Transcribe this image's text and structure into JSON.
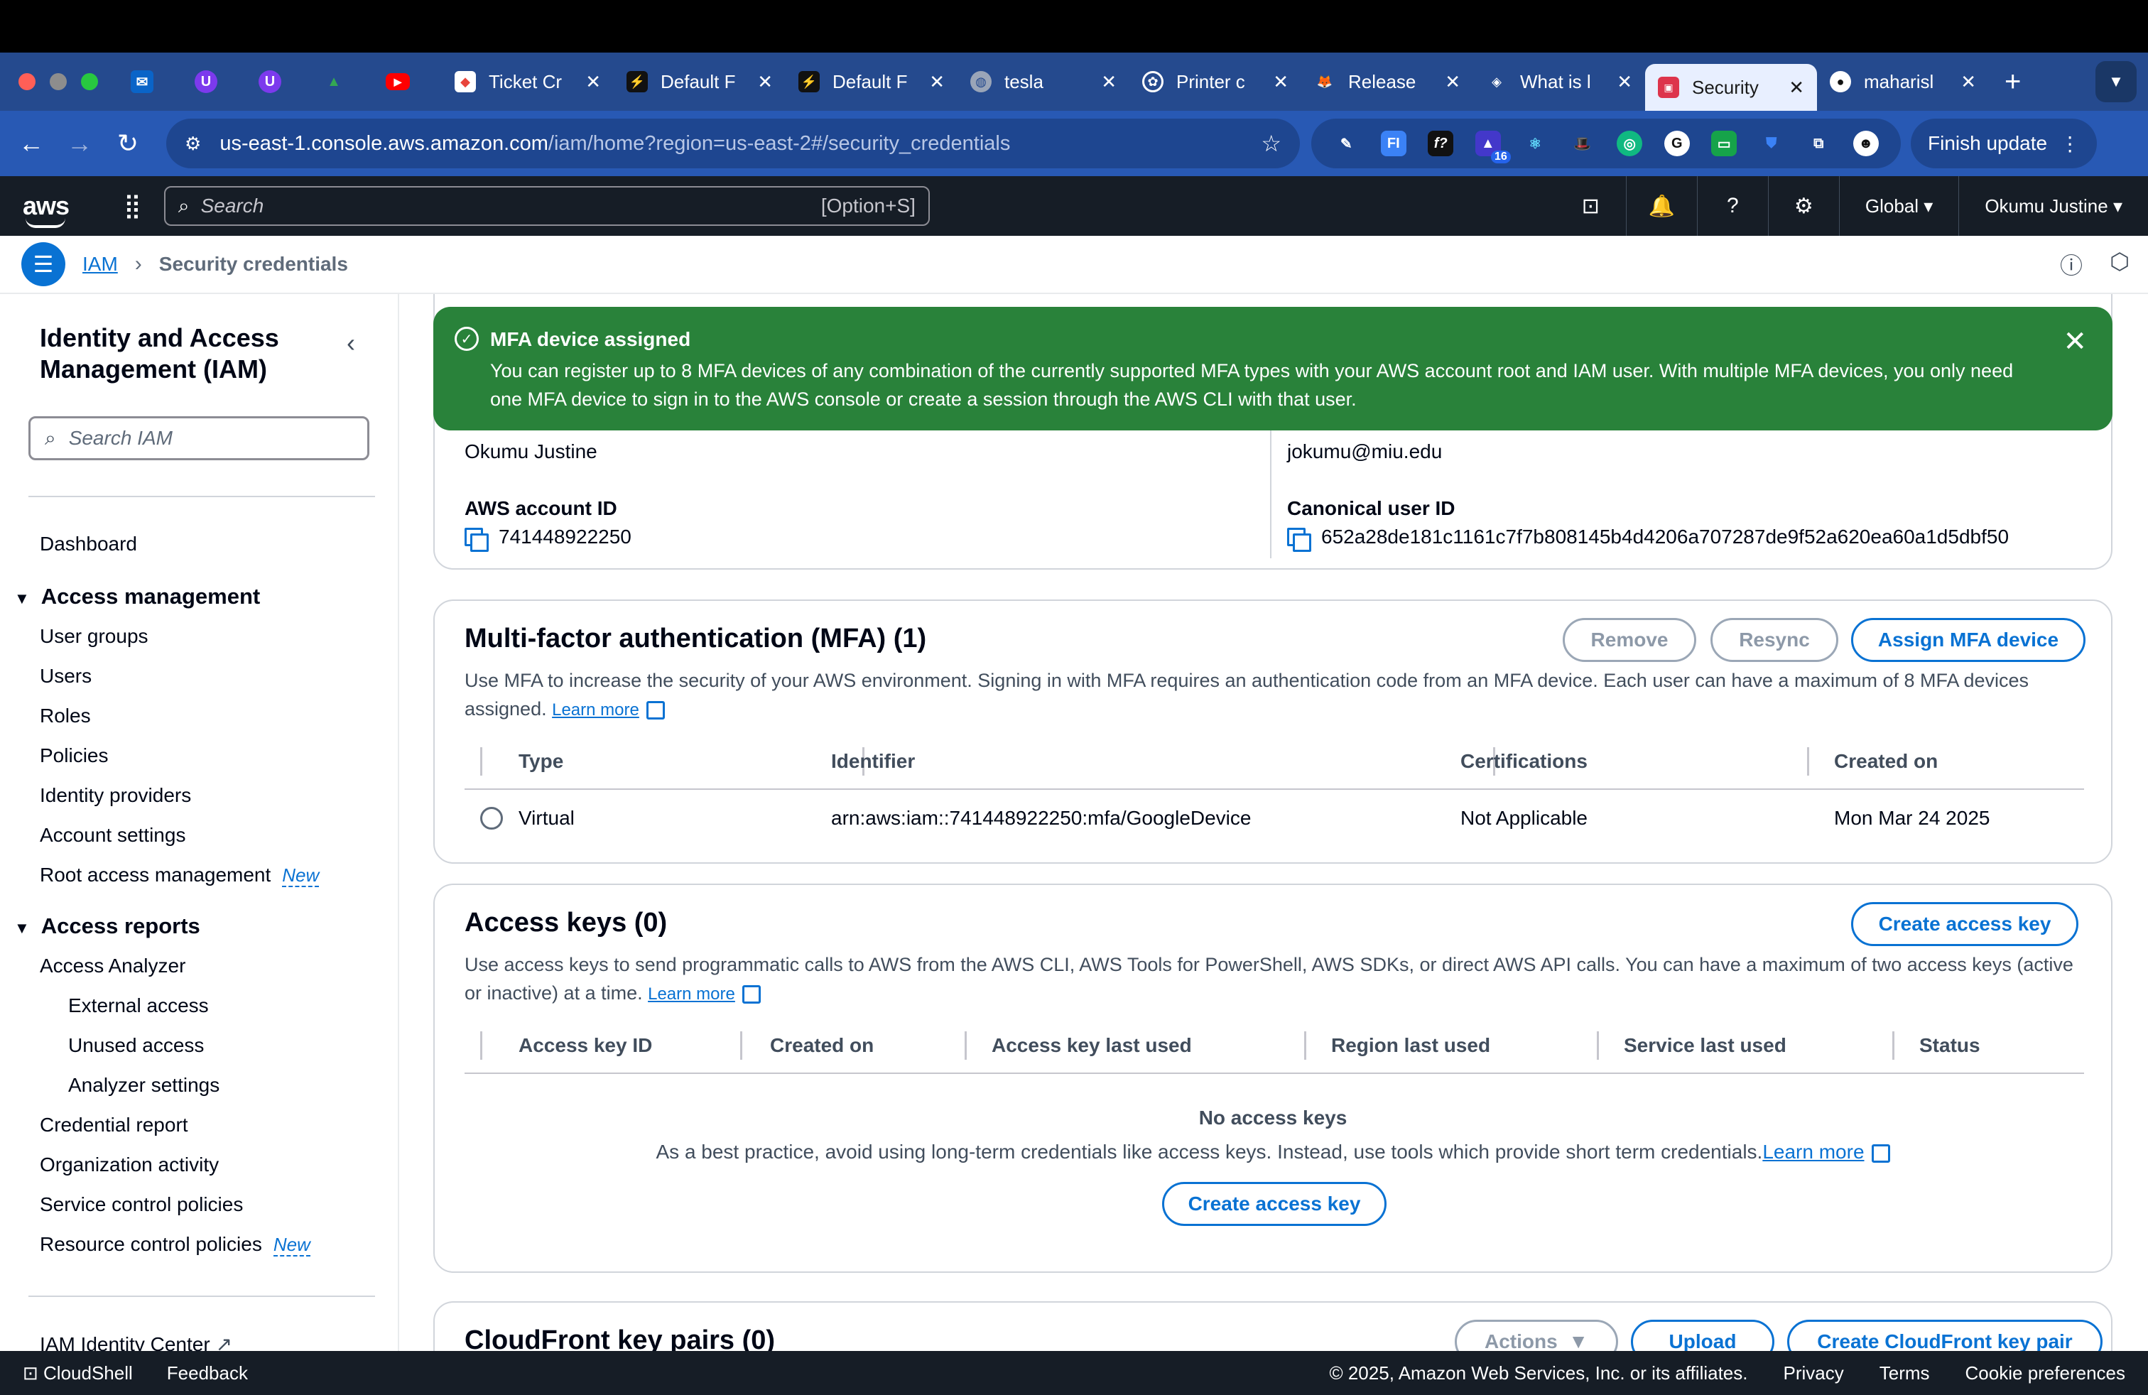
{
  "browser": {
    "tabs": [
      {
        "title": "Ticket Cr",
        "icon": "ticket-icon",
        "color": "#e8453c"
      },
      {
        "title": "Default F",
        "icon": "bolt-icon",
        "color": "#1f2937"
      },
      {
        "title": "Default F",
        "icon": "bolt-icon",
        "color": "#1f2937"
      },
      {
        "title": "tesla",
        "icon": "globe-icon",
        "color": "#6b7280"
      },
      {
        "title": "Printer c",
        "icon": "openai-icon",
        "color": "#111827"
      },
      {
        "title": "Release",
        "icon": "gitlab-icon",
        "color": "#e24329"
      },
      {
        "title": "What is l",
        "icon": "hf-icon",
        "color": "#374151"
      },
      {
        "title": "Security",
        "icon": "aws-icon",
        "color": "#c7254e"
      },
      {
        "title": "maharisl",
        "icon": "github-icon",
        "color": "#111827"
      }
    ],
    "url_host": "us-east-1.console.aws.amazon.com",
    "url_path": "/iam/home?region=us-east-2#/security_credentials",
    "extension_badge": "16",
    "finish_update": "Finish update"
  },
  "aws_nav": {
    "logo": "aws",
    "search_placeholder": "Search",
    "search_shortcut": "[Option+S]",
    "region": "Global",
    "account": "Okumu Justine"
  },
  "breadcrumb": {
    "root": "IAM",
    "current": "Security credentials"
  },
  "sidebar": {
    "title": "Identity and Access Management (IAM)",
    "search_placeholder": "Search IAM",
    "dashboard": "Dashboard",
    "access_management": "Access management",
    "am_items": [
      "User groups",
      "Users",
      "Roles",
      "Policies",
      "Identity providers",
      "Account settings",
      "Root access management"
    ],
    "access_reports": "Access reports",
    "access_analyzer": "Access Analyzer",
    "analyzer_items": [
      "External access",
      "Unused access",
      "Analyzer settings"
    ],
    "ar_items": [
      "Credential report",
      "Organization activity",
      "Service control policies",
      "Resource control policies"
    ],
    "new_tag": "New",
    "identity_center": "IAM Identity Center"
  },
  "flash": {
    "title": "MFA device assigned",
    "body": "You can register up to 8 MFA devices of any combination of the currently supported MFA types with your AWS account root and IAM user. With multiple MFA devices, you only need one MFA device to sign in to the AWS console or create a session through the AWS CLI with that user."
  },
  "account": {
    "name": "Okumu Justine",
    "email": "jokumu@miu.edu",
    "account_id_label": "AWS account ID",
    "account_id": "741448922250",
    "canonical_label": "Canonical user ID",
    "canonical_id": "652a28de181c1161c7f7b808145b4d4206a707287de9f52a620ea60a1d5dbf50"
  },
  "mfa": {
    "title": "Multi-factor authentication (MFA) (1)",
    "remove": "Remove",
    "resync": "Resync",
    "assign": "Assign MFA device",
    "desc": "Use MFA to increase the security of your AWS environment. Signing in with MFA requires an authentication code from an MFA device. Each user can have a maximum of 8 MFA devices assigned.",
    "learn_more": "Learn more",
    "headers": [
      "Type",
      "Identifier",
      "Certifications",
      "Created on"
    ],
    "row": {
      "type": "Virtual",
      "identifier": "arn:aws:iam::741448922250:mfa/GoogleDevice",
      "certifications": "Not Applicable",
      "created": "Mon Mar 24 2025"
    }
  },
  "access_keys": {
    "title": "Access keys (0)",
    "create": "Create access key",
    "desc": "Use access keys to send programmatic calls to AWS from the AWS CLI, AWS Tools for PowerShell, AWS SDKs, or direct AWS API calls. You can have a maximum of two access keys (active or inactive) at a time.",
    "learn_more": "Learn more",
    "headers": [
      "Access key ID",
      "Created on",
      "Access key last used",
      "Region last used",
      "Service last used",
      "Status"
    ],
    "empty_title": "No access keys",
    "empty_desc": "As a best practice, avoid using long-term credentials like access keys. Instead, use tools which provide short term credentials.",
    "empty_learn": "Learn more",
    "empty_create": "Create access key"
  },
  "cloudfront": {
    "title": "CloudFront key pairs (0)",
    "actions": "Actions",
    "upload": "Upload",
    "create": "Create CloudFront key pair"
  },
  "footer": {
    "cloudshell": "CloudShell",
    "feedback": "Feedback",
    "copyright": "© 2025, Amazon Web Services, Inc. or its affiliates.",
    "privacy": "Privacy",
    "terms": "Terms",
    "cookies": "Cookie preferences"
  }
}
